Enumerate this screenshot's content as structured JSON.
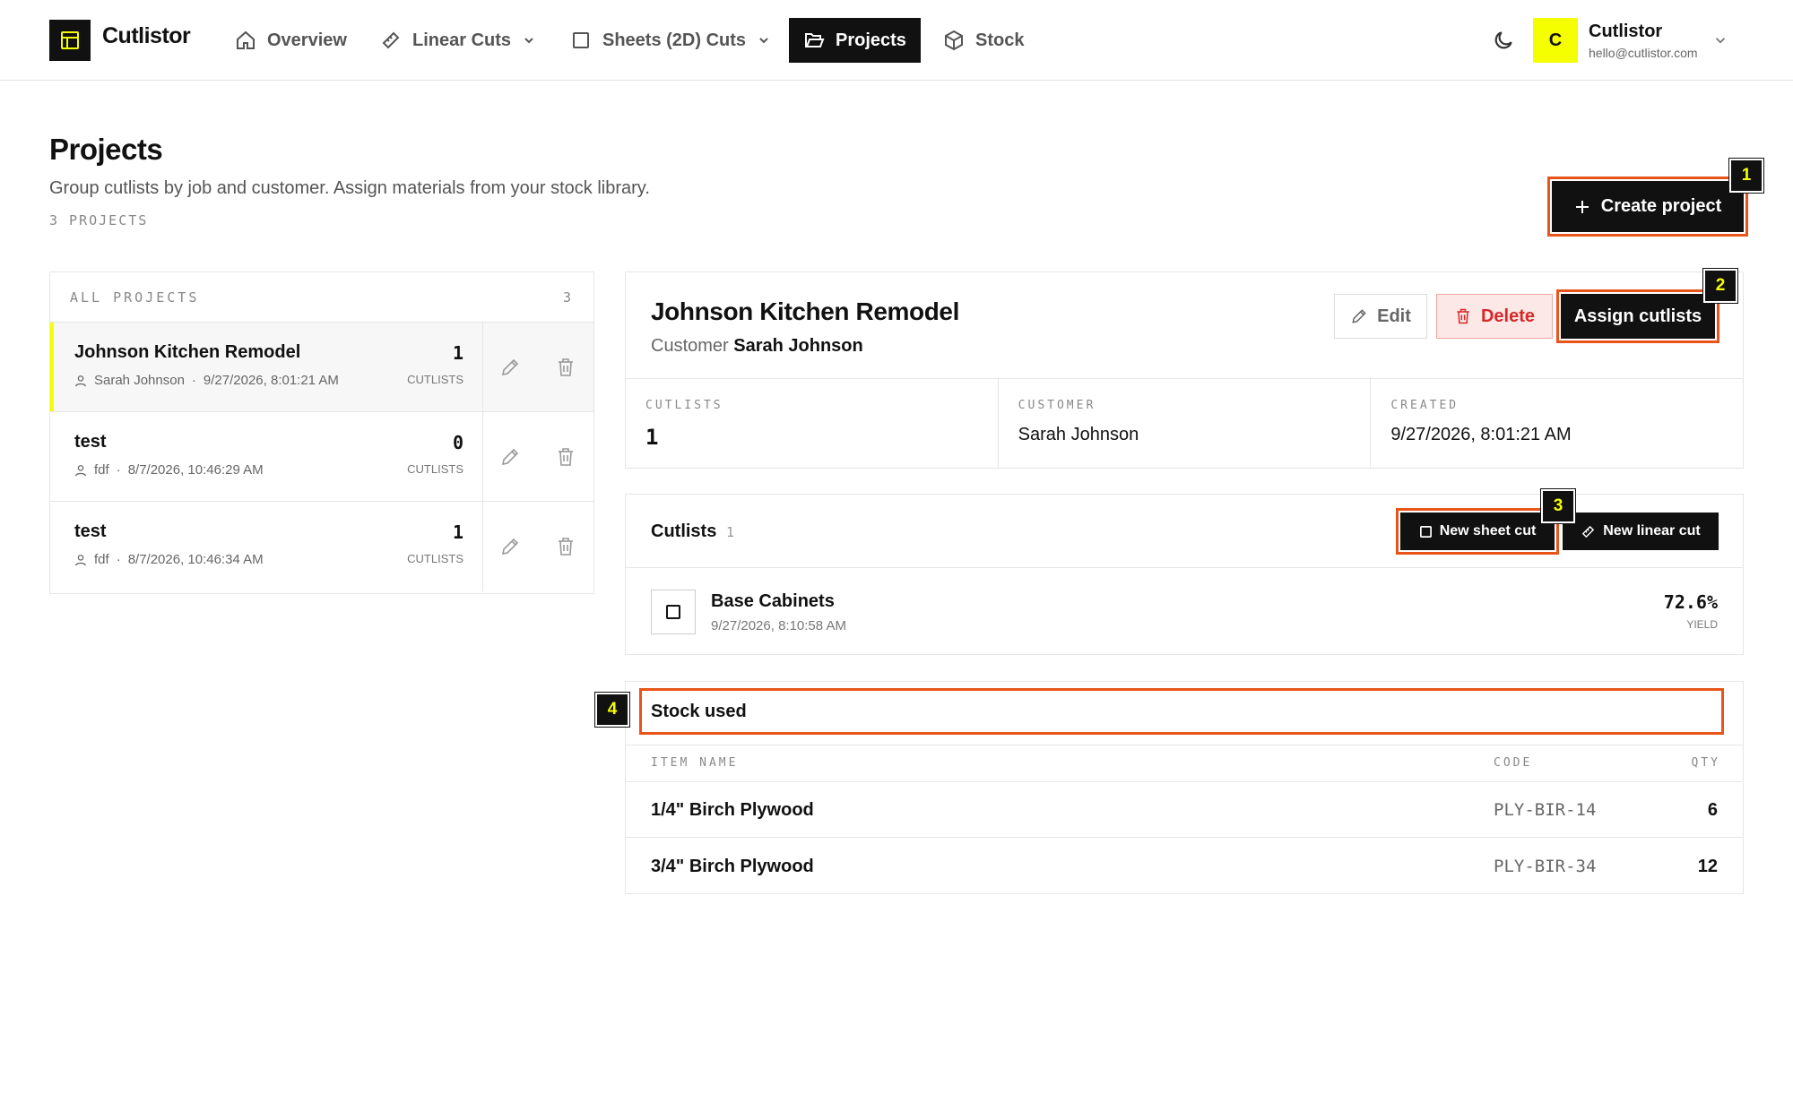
{
  "app": {
    "brand": "Cutlistor"
  },
  "nav": {
    "items": [
      {
        "label": "Overview",
        "icon": "home-icon"
      },
      {
        "label": "Linear Cuts",
        "icon": "ruler-icon"
      },
      {
        "label": "Sheets (2D) Cuts",
        "icon": "square-icon"
      },
      {
        "label": "Projects",
        "icon": "folder-open-icon",
        "active": true
      },
      {
        "label": "Stock",
        "icon": "box-icon"
      }
    ]
  },
  "user": {
    "initial": "C",
    "name": "Cutlistor",
    "email": "hello@cutlistor.com"
  },
  "page": {
    "title": "Projects",
    "subtitle": "Group cutlists by job and customer. Assign materials from your stock library.",
    "count_label": "3 PROJECTS",
    "create_label": "Create project"
  },
  "projects_list": {
    "header": "ALL PROJECTS",
    "count": "3",
    "items": [
      {
        "name": "Johnson Kitchen Remodel",
        "customer": "Sarah Johnson",
        "date": "9/27/2026, 8:01:21 AM",
        "cutlists": "1",
        "unit": "CUTLISTS"
      },
      {
        "name": "test",
        "customer": "fdf",
        "date": "8/7/2026, 10:46:29 AM",
        "cutlists": "0",
        "unit": "CUTLISTS"
      },
      {
        "name": "test",
        "customer": "fdf",
        "date": "8/7/2026, 10:46:34 AM",
        "cutlists": "1",
        "unit": "CUTLISTS"
      }
    ]
  },
  "detail": {
    "title": "Johnson Kitchen Remodel",
    "customer_prefix": "Customer",
    "customer": "Sarah Johnson",
    "edit_label": "Edit",
    "delete_label": "Delete",
    "assign_label": "Assign cutlists",
    "stats": [
      {
        "label": "CUTLISTS",
        "value": "1"
      },
      {
        "label": "CUSTOMER",
        "value": "Sarah Johnson"
      },
      {
        "label": "CREATED",
        "value": "9/27/2026, 8:01:21 AM"
      }
    ]
  },
  "cutlists": {
    "title": "Cutlists",
    "count": "1",
    "new_sheet_label": "New sheet cut",
    "new_linear_label": "New linear cut",
    "items": [
      {
        "name": "Base Cabinets",
        "date": "9/27/2026, 8:10:58 AM",
        "yield": "72.6%",
        "yield_label": "YIELD"
      }
    ]
  },
  "stock": {
    "title": "Stock used",
    "columns": {
      "name": "ITEM NAME",
      "code": "CODE",
      "qty": "QTY"
    },
    "rows": [
      {
        "name": "1/4\" Birch Plywood",
        "code": "PLY-BIR-14",
        "qty": "6"
      },
      {
        "name": "3/4\" Birch Plywood",
        "code": "PLY-BIR-34",
        "qty": "12"
      }
    ]
  },
  "markers": [
    "1",
    "2",
    "3",
    "4"
  ],
  "colors": {
    "accent": "#f6ff00",
    "highlight": "#e8541a",
    "danger": "#d62828"
  }
}
